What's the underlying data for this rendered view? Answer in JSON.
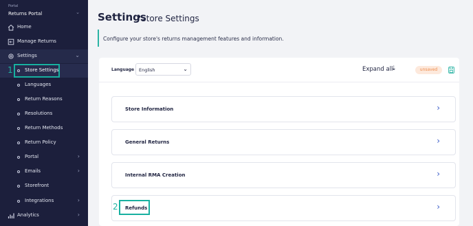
{
  "sidebar": {
    "portal_small": "Portal",
    "portal_name": "Returns Portal",
    "items": [
      {
        "label": "Home",
        "icon": "home-icon"
      },
      {
        "label": "Manage Returns",
        "icon": "returns-icon"
      },
      {
        "label": "Settings",
        "icon": "gear-icon"
      },
      {
        "label": "Store Settings"
      },
      {
        "label": "Languages"
      },
      {
        "label": "Return Reasons"
      },
      {
        "label": "Resolutions"
      },
      {
        "label": "Return Methods"
      },
      {
        "label": "Return Policy"
      },
      {
        "label": "Portal"
      },
      {
        "label": "Emails"
      },
      {
        "label": "Storefront"
      },
      {
        "label": "Integrations"
      },
      {
        "label": "Analytics",
        "icon": "analytics-icon"
      }
    ]
  },
  "header": {
    "title": "Settings",
    "separator": "•",
    "subtitle": "Store Settings"
  },
  "description": "Configure your store's returns management features and information.",
  "toolbar": {
    "language_label": "Language",
    "language_value": "English",
    "expand_all": "Expand all",
    "status_badge": "unsaved"
  },
  "sections": [
    {
      "label": "Store Information"
    },
    {
      "label": "General Returns"
    },
    {
      "label": "Internal RMA Creation"
    },
    {
      "label": "Refunds"
    }
  ],
  "annotations": {
    "step1": "1",
    "step2": "2"
  },
  "colors": {
    "sidebar_bg": "#1c1f3c",
    "highlight": "#17b0a0",
    "chevron_blue": "#3a5cc8",
    "badge_bg": "#fde9dc",
    "badge_text": "#ee8a4a"
  }
}
